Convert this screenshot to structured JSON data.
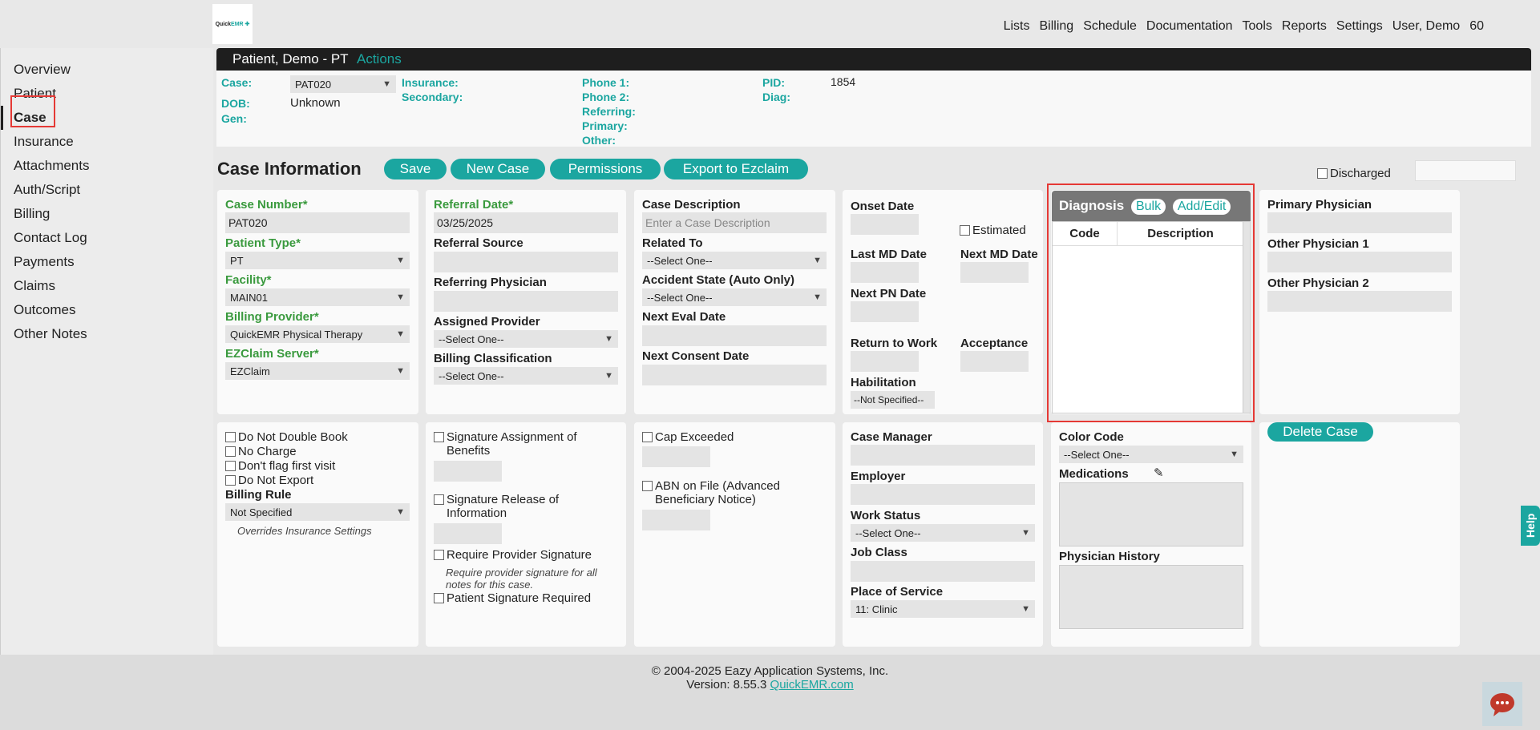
{
  "logo": {
    "text_a": "Quick",
    "text_b": "EMR"
  },
  "topnav": [
    "Lists",
    "Billing",
    "Schedule",
    "Documentation",
    "Tools",
    "Reports",
    "Settings",
    "User, Demo",
    "60"
  ],
  "sidebar": {
    "items": [
      "Overview",
      "Patient",
      "Case",
      "Insurance",
      "Attachments",
      "Auth/Script",
      "Billing",
      "Contact Log",
      "Payments",
      "Claims",
      "Outcomes",
      "Other Notes"
    ],
    "active": "Case"
  },
  "patient_bar": {
    "name": "Patient, Demo - PT",
    "actions": "Actions"
  },
  "patient_info": {
    "case_label": "Case:",
    "case_value": "PAT020",
    "dob_label": "DOB:",
    "dob_value": "Unknown",
    "gen_label": "Gen:",
    "insurance_label": "Insurance:",
    "secondary_label": "Secondary:",
    "phone1_label": "Phone 1:",
    "phone2_label": "Phone 2:",
    "referring_label": "Referring:",
    "primary_label": "Primary:",
    "other_label": "Other:",
    "pid_label": "PID:",
    "pid_value": "1854",
    "diag_label": "Diag:"
  },
  "case_header": {
    "title": "Case Information",
    "save": "Save",
    "new_case": "New Case",
    "permissions": "Permissions",
    "export": "Export to Ezclaim",
    "discharged": "Discharged"
  },
  "col1": {
    "case_number_label": "Case Number*",
    "case_number": "PAT020",
    "patient_type_label": "Patient Type*",
    "patient_type": "PT",
    "facility_label": "Facility*",
    "facility": "MAIN01",
    "billing_provider_label": "Billing Provider*",
    "billing_provider": "QuickEMR Physical Therapy",
    "ezclaim_label": "EZClaim Server*",
    "ezclaim": "EZClaim"
  },
  "col2": {
    "referral_date_label": "Referral Date*",
    "referral_date": "03/25/2025",
    "referral_source_label": "Referral Source",
    "referring_physician_label": "Referring Physician",
    "assigned_provider_label": "Assigned Provider",
    "assigned_provider": "--Select One--",
    "billing_class_label": "Billing Classification",
    "billing_class": "--Select One--"
  },
  "col3": {
    "case_desc_label": "Case Description",
    "case_desc_placeholder": "Enter a Case Description",
    "related_to_label": "Related To",
    "related_to": "--Select One--",
    "accident_state_label": "Accident State (Auto Only)",
    "accident_state": "--Select One--",
    "next_eval_label": "Next Eval Date",
    "next_consent_label": "Next Consent Date"
  },
  "col4": {
    "onset_label": "Onset Date",
    "estimated_label": "Estimated",
    "last_md_label": "Last MD Date",
    "next_md_label": "Next MD Date",
    "next_pn_label": "Next PN Date",
    "return_work_label": "Return to Work",
    "acceptance_label": "Acceptance",
    "habilitation_label": "Habilitation",
    "habilitation": "--Not Specified--"
  },
  "diagnosis": {
    "title": "Diagnosis",
    "bulk": "Bulk",
    "add_edit": "Add/Edit",
    "col_code": "Code",
    "col_desc": "Description"
  },
  "col6": {
    "primary_physician_label": "Primary Physician",
    "other1_label": "Other Physician 1",
    "other2_label": "Other Physician 2"
  },
  "bottom1": {
    "do_not_double_book": "Do Not Double Book",
    "no_charge": "No Charge",
    "dont_flag": "Don't flag first visit",
    "do_not_export": "Do Not Export",
    "billing_rule_label": "Billing Rule",
    "billing_rule": "Not Specified",
    "overrides_note": "Overrides Insurance Settings"
  },
  "bottom2": {
    "sig_assign": "Signature Assignment of Benefits",
    "sig_release": "Signature Release of Information",
    "require_provider": "Require Provider Signature",
    "require_note": "Require provider signature for all notes for this case.",
    "patient_sig": "Patient Signature Required"
  },
  "bottom3": {
    "cap_exceeded": "Cap Exceeded",
    "abn": "ABN on File (Advanced Beneficiary Notice)"
  },
  "bottom4": {
    "case_manager_label": "Case Manager",
    "employer_label": "Employer",
    "work_status_label": "Work Status",
    "work_status": "--Select One--",
    "job_class_label": "Job Class",
    "place_of_service_label": "Place of Service",
    "place_of_service": "11: Clinic"
  },
  "bottom5": {
    "color_code_label": "Color Code",
    "color_code": "--Select One--",
    "medications_label": "Medications",
    "physician_history_label": "Physician History"
  },
  "delete_case": "Delete Case",
  "footer": {
    "copyright": "© 2004-2025 Eazy Application Systems, Inc.",
    "version_prefix": "Version: 8.55.3",
    "link": "QuickEMR.com"
  },
  "help": "Help",
  "colors": {
    "accent": "#1ba6a0",
    "required_label": "#3a9a3e",
    "highlight": "#e53935"
  }
}
